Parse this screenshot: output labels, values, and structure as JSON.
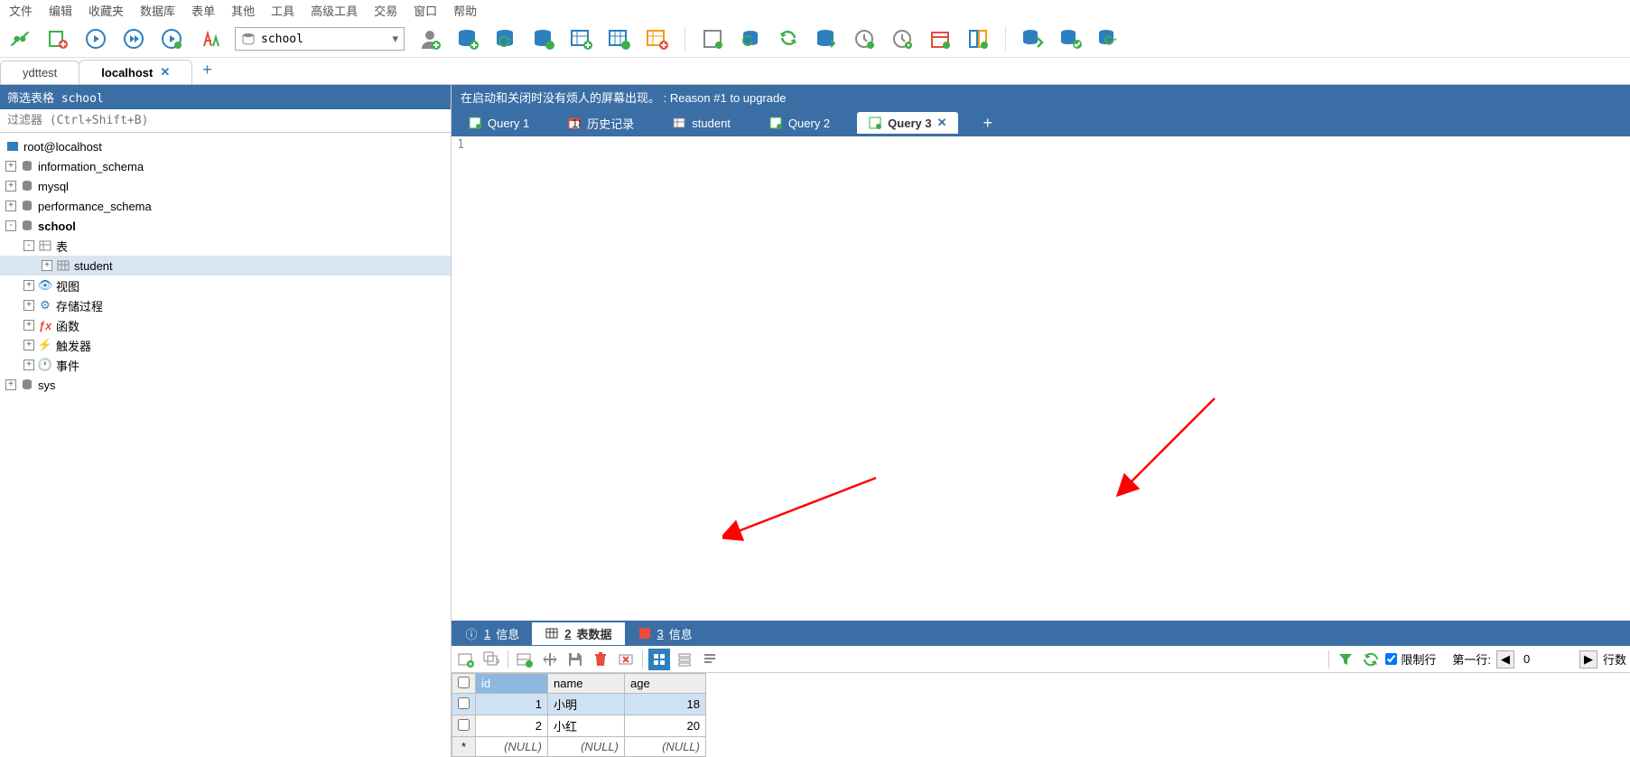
{
  "menu": [
    "文件",
    "编辑",
    "收藏夹",
    "数据库",
    "表单",
    "其他",
    "工具",
    "高级工具",
    "交易",
    "窗口",
    "帮助"
  ],
  "db_selector": {
    "value": "school"
  },
  "conn_tabs": [
    {
      "label": "ydttest",
      "active": false,
      "closable": false
    },
    {
      "label": "localhost",
      "active": true,
      "closable": true
    }
  ],
  "sidebar": {
    "filter_title": "筛选表格 school",
    "filter_placeholder": "过滤器 (Ctrl+Shift+B)",
    "root": "root@localhost",
    "databases": [
      {
        "name": "information_schema",
        "exp": "+"
      },
      {
        "name": "mysql",
        "exp": "+"
      },
      {
        "name": "performance_schema",
        "exp": "+"
      },
      {
        "name": "school",
        "exp": "-",
        "bold": true,
        "children": [
          {
            "name": "表",
            "exp": "-",
            "icon": "table",
            "children": [
              {
                "name": "student",
                "exp": "+",
                "icon": "table",
                "sel": true
              }
            ]
          },
          {
            "name": "视图",
            "exp": "+",
            "icon": "view"
          },
          {
            "name": "存储过程",
            "exp": "+",
            "icon": "gear"
          },
          {
            "name": "函数",
            "exp": "+",
            "icon": "fx"
          },
          {
            "name": "触发器",
            "exp": "+",
            "icon": "bolt"
          },
          {
            "name": "事件",
            "exp": "+",
            "icon": "clock"
          }
        ]
      },
      {
        "name": "sys",
        "exp": "+"
      }
    ]
  },
  "upgrade_msg": "在启动和关闭时没有烦人的屏幕出现。 : Reason #1 to upgrade",
  "query_tabs": [
    {
      "label": "Query 1",
      "icon": "query",
      "active": false
    },
    {
      "label": "历史记录",
      "icon": "history",
      "active": false
    },
    {
      "label": "student",
      "icon": "table",
      "active": false
    },
    {
      "label": "Query 2",
      "icon": "query",
      "active": false
    },
    {
      "label": "Query 3",
      "icon": "query",
      "active": true,
      "closable": true
    }
  ],
  "editor": {
    "line_no": "1"
  },
  "result_tabs": [
    {
      "num": "1",
      "label": "信息",
      "icon": "info",
      "active": false
    },
    {
      "num": "2",
      "label": "表数据",
      "icon": "table",
      "active": true
    },
    {
      "num": "3",
      "label": "信息",
      "icon": "info-red",
      "active": false
    }
  ],
  "result_toolbar": {
    "limit_label": "限制行",
    "first_row_label": "第一行:",
    "first_row_value": "0",
    "rows_label": "行数"
  },
  "grid": {
    "columns": [
      "id",
      "name",
      "age"
    ],
    "rows": [
      {
        "id": "1",
        "name": "小明",
        "age": "18",
        "sel": true
      },
      {
        "id": "2",
        "name": "小红",
        "age": "20",
        "sel": false
      }
    ],
    "null_row": [
      "(NULL)",
      "(NULL)",
      "(NULL)"
    ]
  }
}
